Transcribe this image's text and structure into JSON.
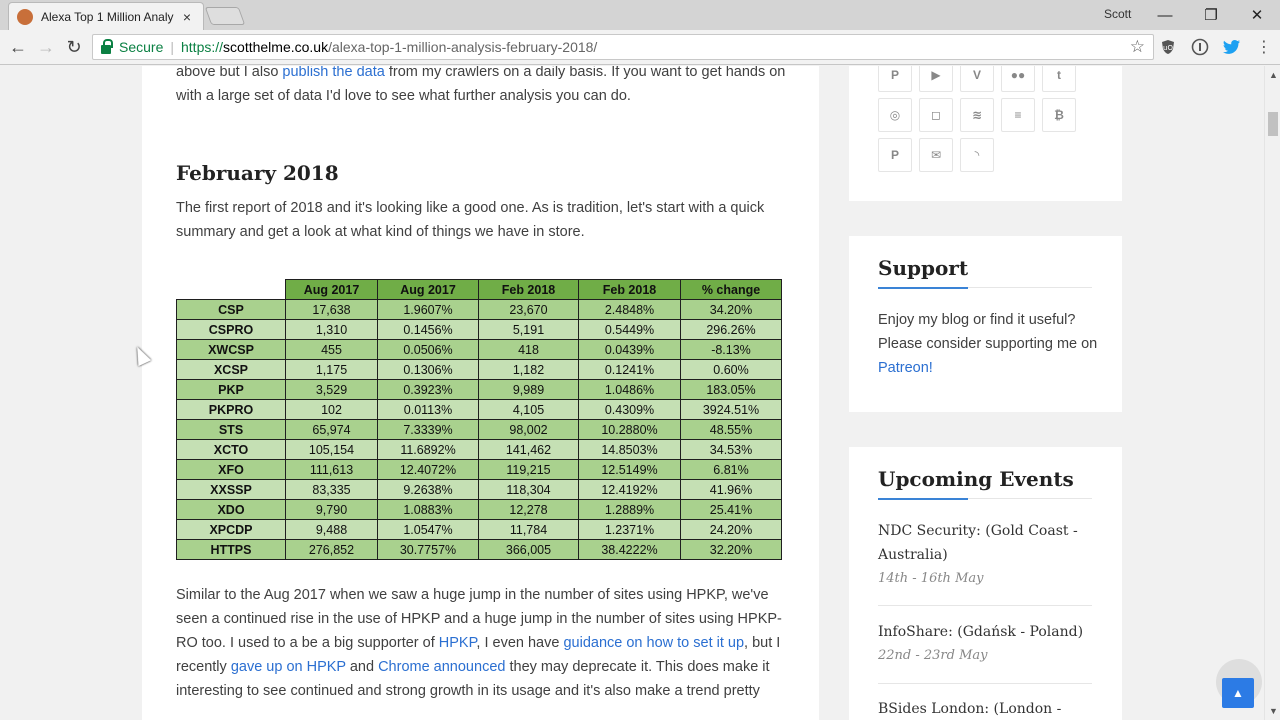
{
  "browser": {
    "tab_title": "Alexa Top 1 Million Analy",
    "tab_close": "×",
    "profile": "Scott",
    "min": "—",
    "restore": "❐",
    "close": "✕",
    "back": "←",
    "forward": "→",
    "reload": "↻",
    "secure_label": "Secure",
    "separator": "|",
    "url_scheme": "https://",
    "url_host": "scotthelme.co.uk",
    "url_path": "/alexa-top-1-million-analysis-february-2018/",
    "bookmark_star": "☆"
  },
  "article": {
    "intro_a": "above but I also ",
    "intro_link": "publish the data",
    "intro_b": " from my crawlers on a daily basis. If you want to get hands on with a large set of data I'd love to see what further analysis you can do.",
    "heading": "February 2018",
    "para2": "The first report of 2018 and it's looking like a good one. As is tradition, let's start with a quick summary and get a look at what kind of things we have in store.",
    "table": {
      "headers": [
        "Aug 2017",
        "Aug 2017",
        "Feb 2018",
        "Feb 2018",
        "% change"
      ],
      "rows": [
        [
          "CSP",
          "17,638",
          "1.9607%",
          "23,670",
          "2.4848%",
          "34.20%"
        ],
        [
          "CSPRO",
          "1,310",
          "0.1456%",
          "5,191",
          "0.5449%",
          "296.26%"
        ],
        [
          "XWCSP",
          "455",
          "0.0506%",
          "418",
          "0.0439%",
          "-8.13%"
        ],
        [
          "XCSP",
          "1,175",
          "0.1306%",
          "1,182",
          "0.1241%",
          "0.60%"
        ],
        [
          "PKP",
          "3,529",
          "0.3923%",
          "9,989",
          "1.0486%",
          "183.05%"
        ],
        [
          "PKPRO",
          "102",
          "0.0113%",
          "4,105",
          "0.4309%",
          "3924.51%"
        ],
        [
          "STS",
          "65,974",
          "7.3339%",
          "98,002",
          "10.2880%",
          "48.55%"
        ],
        [
          "XCTO",
          "105,154",
          "11.6892%",
          "141,462",
          "14.8503%",
          "34.53%"
        ],
        [
          "XFO",
          "111,613",
          "12.4072%",
          "119,215",
          "12.5149%",
          "6.81%"
        ],
        [
          "XXSSP",
          "83,335",
          "9.2638%",
          "118,304",
          "12.4192%",
          "41.96%"
        ],
        [
          "XDO",
          "9,790",
          "1.0883%",
          "12,278",
          "1.2889%",
          "25.41%"
        ],
        [
          "XPCDP",
          "9,488",
          "1.0547%",
          "11,784",
          "1.2371%",
          "24.20%"
        ],
        [
          "HTTPS",
          "276,852",
          "30.7757%",
          "366,005",
          "38.4222%",
          "32.20%"
        ]
      ]
    },
    "p3_a": "Similar to the Aug 2017 when we saw a huge jump in the number of sites using HPKP, we've seen a continued rise in the use of HPKP and a huge jump in the number of sites using HPKP-RO too. I used to a be a big supporter of ",
    "p3_link1": "HPKP",
    "p3_b": ", I even have ",
    "p3_link2": "guidance on how to set it up",
    "p3_c": ", but I recently ",
    "p3_link3": "gave up on HPKP",
    "p3_d": " and ",
    "p3_link4": "Chrome announced",
    "p3_e": " they may deprecate it. This does make it interesting to see continued and strong growth in its usage and it's also make a trend pretty"
  },
  "sidebar": {
    "social_icons": [
      "P",
      "▶",
      "V",
      "●●",
      "t",
      "◎",
      "◻",
      "≋",
      "≡",
      "₿",
      "P",
      "✉",
      "◝"
    ],
    "support_title": "Support",
    "support_text": "Enjoy my blog or find it useful? Please consider supporting me on ",
    "support_link": "Patreon!",
    "events_title": "Upcoming Events",
    "events": [
      {
        "name": "NDC Security: (Gold Coast - Australia)",
        "date": "14th - 16th May"
      },
      {
        "name": "InfoShare: (Gdańsk - Poland)",
        "date": "22nd - 23rd May"
      },
      {
        "name": "BSides London: (London - UK)",
        "date": ""
      }
    ]
  },
  "back_to_top": "▲"
}
